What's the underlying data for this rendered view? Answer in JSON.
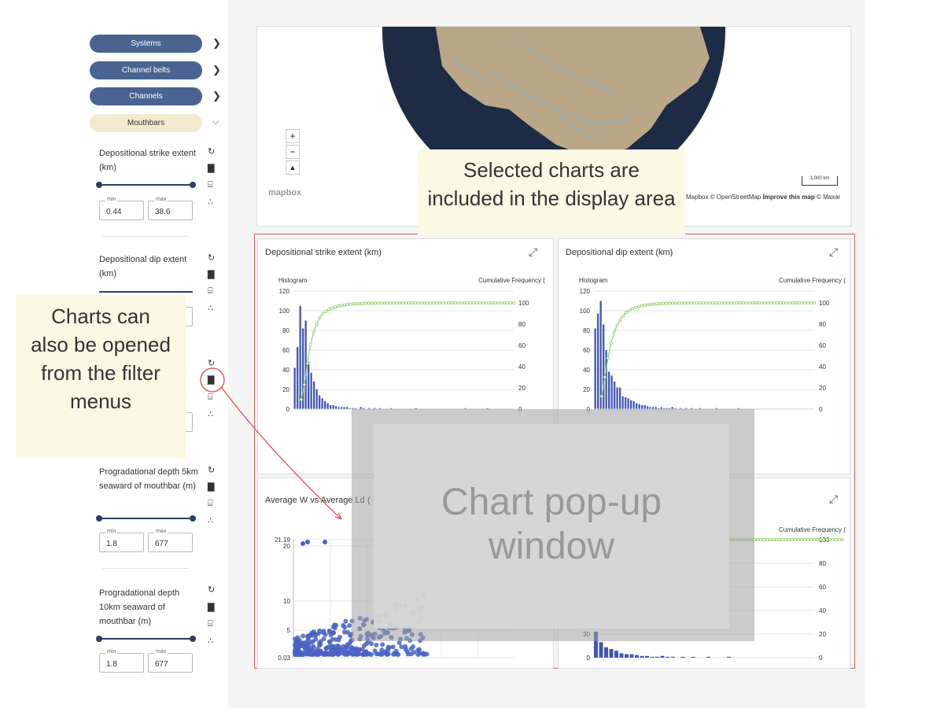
{
  "sidebar": {
    "nav": [
      {
        "label": "Systems"
      },
      {
        "label": "Channel belts"
      },
      {
        "label": "Channels"
      },
      {
        "label": "Mouthbars"
      }
    ],
    "filters": [
      {
        "label": "Depositional strike extent (km)",
        "min_label": "min",
        "max_label": "max",
        "min": "0.44",
        "max": "38.6"
      },
      {
        "label": "Depositional dip extent (km)"
      },
      {
        "label": "Progradational depth 5km seaward of mouthbar (m)",
        "min_label": "min",
        "max_label": "max",
        "min": "1.8",
        "max": "677"
      },
      {
        "label": "Progradational depth 10km seaward of mouthbar (m)",
        "min_label": "min",
        "max_label": "max",
        "min": "1.8",
        "max": "677"
      }
    ]
  },
  "map": {
    "scale_label": "1,000 km",
    "attribution": "Mapbox © OpenStreetMap",
    "improve": "Improve this map",
    "maxar": "© Maxar",
    "logo": "mapbox",
    "zoom_in": "+",
    "zoom_out": "−"
  },
  "annotations": {
    "selected": "Selected charts are included in the display area",
    "filter_menus": "Charts can also be opened from the filter menus",
    "popup": "Chart pop-up window"
  },
  "charts": [
    {
      "title": "Depositional strike extent (km)",
      "left_axis": "Histogram",
      "right_axis": "Cumulative Frequency (",
      "yticks": [
        "120",
        "100",
        "80",
        "60",
        "40",
        "20",
        "0"
      ],
      "y2ticks": [
        "100",
        "80",
        "60",
        "40",
        "20",
        "0"
      ]
    },
    {
      "title": "Depositional dip extent (km)",
      "left_axis": "Histogram",
      "right_axis": "Cumulative Frequency (",
      "yticks": [
        "120",
        "100",
        "80",
        "60",
        "40",
        "20",
        "0"
      ],
      "y2ticks": [
        "100",
        "80",
        "60",
        "40",
        "20",
        "0"
      ]
    },
    {
      "title": "Average W vs Average Ld (",
      "yticks": [
        "21.19",
        "20",
        "10",
        "5",
        "0.03"
      ]
    },
    {
      "right_axis": "Cumulative Frequency (",
      "y2ticks": [
        "100",
        "80",
        "60",
        "40",
        "20",
        "0"
      ],
      "yticks_visible": [
        "30",
        "0"
      ]
    }
  ],
  "chart_data": [
    {
      "type": "bar",
      "title": "Depositional strike extent (km)",
      "ylim": [
        0,
        120
      ],
      "y2lim": [
        0,
        100
      ],
      "values": [
        42,
        63,
        105,
        82,
        90,
        48,
        37,
        28,
        20,
        14,
        11,
        8,
        6,
        4,
        4,
        3,
        2,
        2,
        2,
        2,
        1,
        1,
        1,
        0,
        2,
        1,
        0,
        1,
        0,
        1,
        0,
        1,
        0,
        0,
        0,
        1,
        0,
        0,
        0,
        0,
        0,
        0,
        0,
        0,
        1,
        0,
        0,
        0,
        0,
        0,
        0,
        0,
        0,
        0,
        0,
        0,
        0,
        0,
        0,
        0,
        0,
        0,
        1,
        0,
        0,
        0,
        0,
        0,
        0,
        0,
        1,
        0,
        0,
        0,
        0,
        0,
        0,
        0,
        0,
        0
      ],
      "cumulative": [
        9,
        23,
        43,
        61,
        72,
        80,
        86,
        90,
        92,
        94,
        95,
        96,
        97,
        97.5,
        98,
        98.4,
        98.7,
        99,
        99.2,
        99.3,
        99.4,
        99.5,
        99.6,
        99.6,
        99.7,
        99.7,
        99.7,
        99.8,
        99.8,
        99.8,
        99.9,
        99.9,
        99.9,
        99.9,
        99.9,
        99.9,
        99.9,
        99.9,
        99.9,
        99.9,
        99.9,
        99.9,
        99.9,
        99.9,
        100
      ]
    },
    {
      "type": "bar",
      "title": "Depositional dip extent (km)",
      "ylim": [
        0,
        120
      ],
      "y2lim": [
        0,
        100
      ],
      "values": [
        82,
        97,
        110,
        86,
        60,
        38,
        34,
        28,
        22,
        22,
        13,
        12,
        11,
        9,
        8,
        6,
        5,
        4,
        4,
        3,
        2,
        2,
        2,
        1,
        2,
        1,
        1,
        1,
        2,
        1,
        0,
        1,
        0,
        1,
        0,
        1,
        0,
        0,
        1,
        0,
        0,
        0,
        0,
        0,
        1,
        0,
        0,
        0,
        0,
        0,
        0,
        0,
        1,
        0,
        0,
        0,
        0,
        0,
        0,
        0,
        0,
        0,
        0,
        0,
        0,
        0,
        0,
        0,
        0,
        0,
        0,
        0,
        0,
        0,
        0,
        0,
        0,
        0,
        0,
        0
      ],
      "cumulative": [
        12,
        30,
        48,
        62,
        72,
        79,
        84,
        88,
        91,
        93,
        94.5,
        95.5,
        96.5,
        97.2,
        97.8,
        98.2,
        98.6,
        98.9,
        99.1,
        99.3,
        99.4,
        99.5,
        99.6,
        99.7,
        99.7,
        99.8,
        99.8,
        99.8,
        99.9,
        99.9,
        99.9,
        99.9,
        99.9,
        99.9,
        99.9,
        99.9,
        99.9,
        99.9,
        99.9,
        99.9,
        99.9,
        99.9,
        99.9,
        99.9,
        100
      ]
    },
    {
      "type": "scatter",
      "title": "Average W vs Average Ld",
      "ylim": [
        0.03,
        21.19
      ]
    }
  ]
}
